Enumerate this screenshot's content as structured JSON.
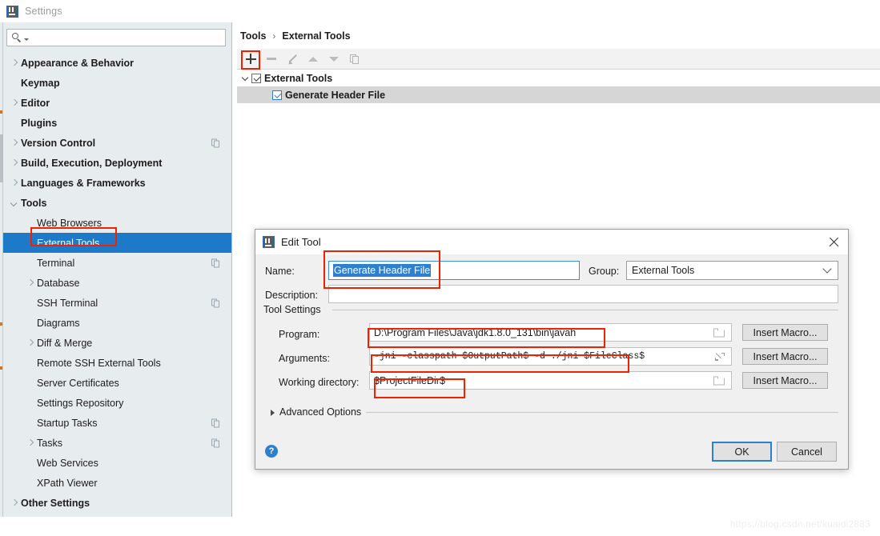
{
  "window": {
    "title": "Settings",
    "logo_icon": "intellij-idea-icon"
  },
  "sidebar": {
    "search": {
      "value": "",
      "placeholder": "",
      "icon": "search-icon"
    },
    "items": [
      {
        "label": "Appearance & Behavior",
        "arrow": "right",
        "bold": true,
        "indent": 0,
        "selected": false,
        "copy": false
      },
      {
        "label": "Keymap",
        "arrow": "none",
        "bold": true,
        "indent": 0,
        "selected": false,
        "copy": false
      },
      {
        "label": "Editor",
        "arrow": "right",
        "bold": true,
        "indent": 0,
        "selected": false,
        "copy": false
      },
      {
        "label": "Plugins",
        "arrow": "none",
        "bold": true,
        "indent": 0,
        "selected": false,
        "copy": false
      },
      {
        "label": "Version Control",
        "arrow": "right",
        "bold": true,
        "indent": 0,
        "selected": false,
        "copy": true
      },
      {
        "label": "Build, Execution, Deployment",
        "arrow": "right",
        "bold": true,
        "indent": 0,
        "selected": false,
        "copy": false
      },
      {
        "label": "Languages & Frameworks",
        "arrow": "right",
        "bold": true,
        "indent": 0,
        "selected": false,
        "copy": false
      },
      {
        "label": "Tools",
        "arrow": "down",
        "bold": true,
        "indent": 0,
        "selected": false,
        "copy": false
      },
      {
        "label": "Web Browsers",
        "arrow": "none",
        "bold": false,
        "indent": 1,
        "selected": false,
        "copy": false
      },
      {
        "label": "External Tools",
        "arrow": "none",
        "bold": false,
        "indent": 1,
        "selected": true,
        "copy": false
      },
      {
        "label": "Terminal",
        "arrow": "none",
        "bold": false,
        "indent": 1,
        "selected": false,
        "copy": true
      },
      {
        "label": "Database",
        "arrow": "right",
        "bold": false,
        "indent": 1,
        "selected": false,
        "copy": false
      },
      {
        "label": "SSH Terminal",
        "arrow": "none",
        "bold": false,
        "indent": 1,
        "selected": false,
        "copy": true
      },
      {
        "label": "Diagrams",
        "arrow": "none",
        "bold": false,
        "indent": 1,
        "selected": false,
        "copy": false
      },
      {
        "label": "Diff & Merge",
        "arrow": "right",
        "bold": false,
        "indent": 1,
        "selected": false,
        "copy": false
      },
      {
        "label": "Remote SSH External Tools",
        "arrow": "none",
        "bold": false,
        "indent": 1,
        "selected": false,
        "copy": false
      },
      {
        "label": "Server Certificates",
        "arrow": "none",
        "bold": false,
        "indent": 1,
        "selected": false,
        "copy": false
      },
      {
        "label": "Settings Repository",
        "arrow": "none",
        "bold": false,
        "indent": 1,
        "selected": false,
        "copy": false
      },
      {
        "label": "Startup Tasks",
        "arrow": "none",
        "bold": false,
        "indent": 1,
        "selected": false,
        "copy": true
      },
      {
        "label": "Tasks",
        "arrow": "right",
        "bold": false,
        "indent": 1,
        "selected": false,
        "copy": true
      },
      {
        "label": "Web Services",
        "arrow": "none",
        "bold": false,
        "indent": 1,
        "selected": false,
        "copy": false
      },
      {
        "label": "XPath Viewer",
        "arrow": "none",
        "bold": false,
        "indent": 1,
        "selected": false,
        "copy": false
      },
      {
        "label": "Other Settings",
        "arrow": "right",
        "bold": true,
        "indent": 0,
        "selected": false,
        "copy": false
      }
    ]
  },
  "main": {
    "breadcrumb": {
      "parent": "Tools",
      "separator": "›",
      "current": "External Tools"
    },
    "toolbar": [
      {
        "name": "add-button",
        "icon": "plus-icon",
        "enabled": true
      },
      {
        "name": "remove-button",
        "icon": "minus-icon",
        "enabled": false
      },
      {
        "name": "edit-button",
        "icon": "pencil-icon",
        "enabled": false
      },
      {
        "name": "move-up-button",
        "icon": "arrow-up-icon",
        "enabled": false
      },
      {
        "name": "move-down-button",
        "icon": "arrow-down-icon",
        "enabled": false
      },
      {
        "name": "copy-button",
        "icon": "copy-icon",
        "enabled": false
      }
    ],
    "tree": [
      {
        "label": "External Tools",
        "checked": true,
        "checkbox_style": "gray",
        "arrow": "down",
        "indent": 0,
        "selected": false
      },
      {
        "label": "Generate Header File",
        "checked": true,
        "checkbox_style": "blue",
        "arrow": "none",
        "indent": 1,
        "selected": true
      }
    ]
  },
  "dialog": {
    "title": "Edit Tool",
    "logo_icon": "intellij-idea-icon",
    "close_icon": "close-icon",
    "name_label": "Name:",
    "name_value": "Generate Header File",
    "group_label": "Group:",
    "group_value": "External Tools",
    "description_label": "Description:",
    "description_value": "",
    "tool_settings_label": "Tool Settings",
    "program_label": "Program:",
    "program_value": "D:\\Program Files\\Java\\jdk1.8.0_131\\bin\\javah",
    "arguments_label": "Arguments:",
    "arguments_value": "-jni -classpath $OutputPath$ -d ./jni $FileClass$",
    "working_dir_label": "Working directory:",
    "working_dir_value": "$ProjectFileDir$",
    "insert_macro_label": "Insert Macro...",
    "advanced_options_label": "Advanced Options",
    "help_label": "?",
    "ok_label": "OK",
    "cancel_label": "Cancel"
  },
  "watermark": {
    "text": "https://blog.csdn.net/kuaidi2883"
  },
  "colors": {
    "selection_blue": "#1c7ac9",
    "accent_blue": "#2d7fd0",
    "annotation_red": "#ee2200",
    "sidebar_bg": "#e7ecef",
    "dialog_bg": "#f0f0f0"
  }
}
